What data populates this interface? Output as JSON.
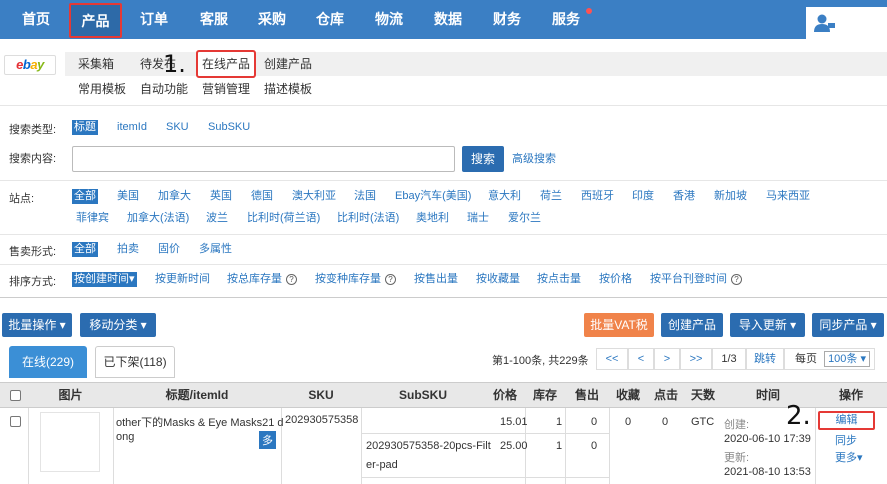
{
  "topnav": {
    "items": [
      "首页",
      "产品",
      "订单",
      "客服",
      "采购",
      "仓库",
      "物流",
      "数据",
      "财务",
      "服务"
    ]
  },
  "subnav": {
    "logo": "ebay",
    "row1": [
      "采集箱",
      "待发布",
      "在线产品",
      "创建产品"
    ],
    "row2": [
      "常用模板",
      "自动功能",
      "营销管理",
      "描述模板"
    ]
  },
  "annotations": {
    "step1": "1.",
    "step2": "2."
  },
  "filters": {
    "search_type_label": "搜索类型:",
    "search_types": [
      "标题",
      "itemId",
      "SKU",
      "SubSKU"
    ],
    "search_content_label": "搜索内容:",
    "search_button": "搜索",
    "advanced_search": "高级搜索",
    "site_label": "站点:",
    "sites_row1": [
      "全部",
      "美国",
      "加拿大",
      "英国",
      "德国",
      "澳大利亚",
      "法国",
      "Ebay汽车(美国)",
      "意大利",
      "荷兰",
      "西班牙",
      "印度",
      "香港",
      "新加坡",
      "马来西亚"
    ],
    "sites_row2": [
      "菲律宾",
      "加拿大(法语)",
      "波兰",
      "比利时(荷兰语)",
      "比利时(法语)",
      "奥地利",
      "瑞士",
      "爱尔兰"
    ],
    "sale_form_label": "售卖形式:",
    "sale_forms": [
      "全部",
      "拍卖",
      "固价",
      "多属性"
    ],
    "sort_label": "排序方式:",
    "sorts": [
      "按创建时间▾",
      "按更新时间",
      "按总库存量",
      "按变种库存量",
      "按售出量",
      "按收藏量",
      "按点击量",
      "按价格",
      "按平台刊登时间"
    ],
    "sort_help": "?"
  },
  "toolbar": {
    "batch_ops": "批量操作 ▾",
    "move_category": "移动分类 ▾",
    "batch_vat": "批量VAT税",
    "create_product": "创建产品",
    "import_update": "导入更新 ▾",
    "sync_product": "同步产品 ▾"
  },
  "tabs": {
    "online": "在线(229)",
    "delisted": "已下架(118)"
  },
  "pager": {
    "summary": "第1-100条, 共229条",
    "first": "<<",
    "prev": "<",
    "next": ">",
    "last": ">>",
    "page": "1/3",
    "jump": "跳转",
    "per_page_label": "每页",
    "per_page_value": "100条 ▾"
  },
  "table": {
    "headers": [
      "图片",
      "标题/itemId",
      "SKU",
      "SubSKU",
      "价格",
      "库存",
      "售出",
      "收藏",
      "点击",
      "天数",
      "时间",
      "操作"
    ],
    "row": {
      "title": "other下的Masks & Eye Masks21 d",
      "title2": "ong",
      "multi": "多",
      "sku": "202930575358",
      "variants": [
        {
          "subsku": "",
          "price": "15.01",
          "stock": "1",
          "sold": "0"
        },
        {
          "subsku": "202930575358-20pcs-Filt",
          "subsku2": "er-pad",
          "price": "25.00",
          "stock": "1",
          "sold": "0"
        }
      ],
      "favorites": "0",
      "clicks": "0",
      "days": "GTC",
      "created_label": "创建:",
      "created": "2020-06-10 17:39",
      "updated_label": "更新:",
      "updated": "2021-08-10 13:53",
      "actions": [
        "编辑",
        "同步",
        "更多▾"
      ]
    }
  }
}
